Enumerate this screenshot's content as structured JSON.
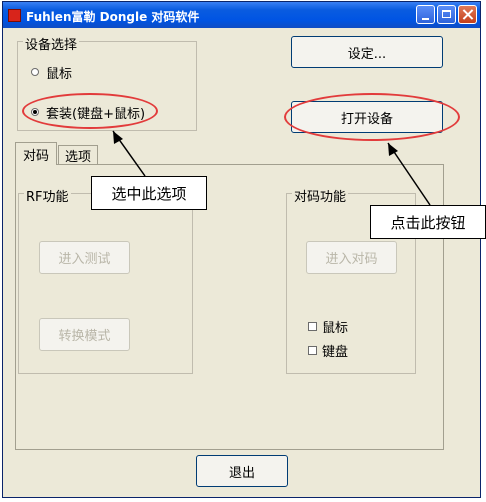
{
  "window": {
    "title": "Fuhlen富勒 Dongle 对码软件"
  },
  "device_select": {
    "label": "设备选择",
    "options": [
      {
        "label": "鼠标",
        "checked": false
      },
      {
        "label": "套装(键盘+鼠标)",
        "checked": true
      }
    ]
  },
  "buttons": {
    "settings": "设定...",
    "open_device": "打开设备",
    "exit": "退出"
  },
  "tabs": [
    {
      "label": "对码",
      "active": true
    },
    {
      "label": "选项",
      "active": false
    }
  ],
  "rf_group": {
    "label": "RF功能",
    "test_button": "进入测试",
    "mode_button": "转换模式"
  },
  "pair_group": {
    "label": "对码功能",
    "pair_button": "进入对码",
    "checks": [
      {
        "label": "鼠标",
        "checked": false
      },
      {
        "label": "键盘",
        "checked": false
      }
    ]
  },
  "annotations": {
    "select_option": "选中此选项",
    "click_button": "点击此按钮",
    "highlight_color": "#e23b3b"
  },
  "colors": {
    "title_bar": "#0054e3",
    "window_bg": "#ece9d8",
    "close_button": "#c43f1b"
  }
}
